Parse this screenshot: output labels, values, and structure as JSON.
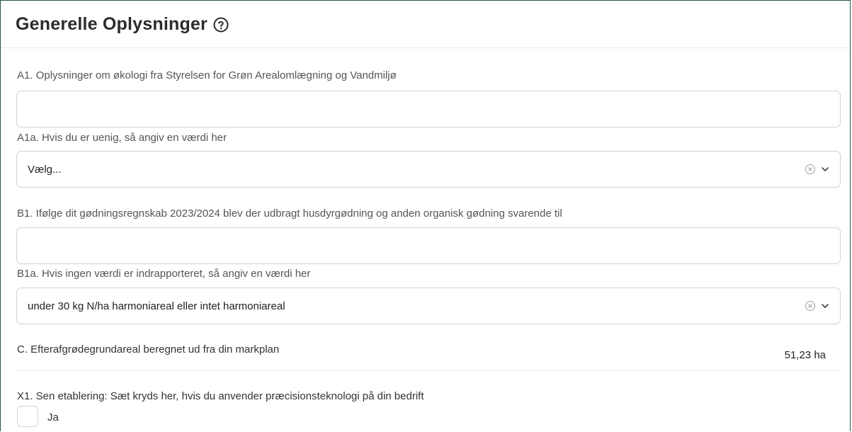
{
  "section": {
    "title": "Generelle Oplysninger",
    "help_icon": "question-circle-icon"
  },
  "fields": {
    "a1": {
      "label": "A1. Oplysninger om økologi fra Styrelsen for Grøn Arealomlægning og Vandmiljø",
      "value": ""
    },
    "a1a": {
      "label": "A1a. Hvis du er uenig, så angiv en værdi her",
      "placeholder": "Vælg..."
    },
    "b1": {
      "label": "B1. Ifølge dit gødningsregnskab 2023/2024 blev der udbragt husdyrgødning og anden organisk gødning svarende til",
      "value": ""
    },
    "b1a": {
      "label": "B1a. Hvis ingen værdi er indrapporteret, så angiv en værdi her",
      "selected": "under 30 kg N/ha harmoniareal eller intet harmoniareal"
    },
    "c": {
      "label": "C. Efterafgrødegrundareal beregnet ud fra din markplan",
      "value": "51,23 ha"
    },
    "x1": {
      "label": "X1. Sen etablering: Sæt kryds her, hvis du anvender præcisionsteknologi på din bedrift",
      "checkbox_label": "Ja",
      "checked": false
    }
  },
  "icons": {
    "clear": "clear-circle-icon",
    "dropdown": "chevron-down-icon"
  }
}
